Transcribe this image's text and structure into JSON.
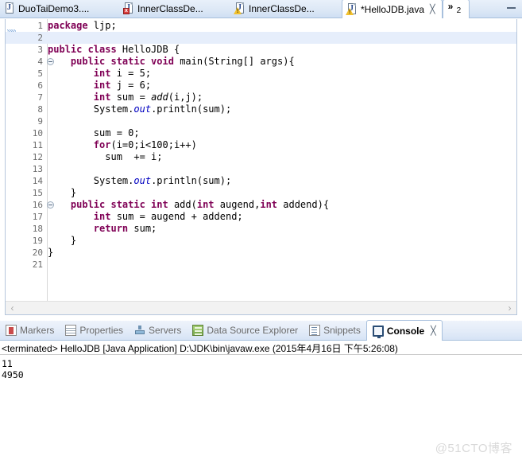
{
  "editor": {
    "tabs": [
      {
        "label": "DuoTaiDemo3....",
        "icon": "java-file-icon",
        "badge": "none",
        "active": false,
        "closable": false
      },
      {
        "label": "InnerClassDe...",
        "icon": "java-file-icon",
        "badge": "error",
        "badge_glyph": "x",
        "active": false,
        "closable": false
      },
      {
        "label": "InnerClassDe...",
        "icon": "java-file-icon",
        "badge": "warning",
        "badge_glyph": "!",
        "active": false,
        "closable": false
      },
      {
        "label": "*HelloJDB.java",
        "icon": "java-file-icon",
        "badge": "warning",
        "badge_glyph": "!",
        "active": true,
        "closable": true,
        "close_glyph": "╳"
      }
    ],
    "overflow": {
      "chevron": "»",
      "count": "2",
      "name": "more-tabs-chevron"
    },
    "minimize_button": "minimize-icon",
    "hscroll": {
      "left_arrow": "‹",
      "right_arrow": "›"
    },
    "current_line": 2,
    "code_lines": [
      {
        "n": "1",
        "fold": false,
        "tokens": [
          {
            "t": "package ",
            "c": "kw"
          },
          {
            "t": "ljp;",
            "c": "pl"
          }
        ]
      },
      {
        "n": "2",
        "fold": false,
        "tokens": [
          {
            "t": "",
            "c": "pl"
          }
        ]
      },
      {
        "n": "3",
        "fold": false,
        "tokens": [
          {
            "t": "public class ",
            "c": "kw"
          },
          {
            "t": "HelloJDB {",
            "c": "pl"
          }
        ]
      },
      {
        "n": "4",
        "fold": true,
        "tokens": [
          {
            "t": "    ",
            "c": "pl"
          },
          {
            "t": "public static void ",
            "c": "kw"
          },
          {
            "t": "main(",
            "c": "pl"
          },
          {
            "t": "String[] args){",
            "c": "pl"
          }
        ]
      },
      {
        "n": "5",
        "fold": false,
        "tokens": [
          {
            "t": "        ",
            "c": "pl"
          },
          {
            "t": "int ",
            "c": "kw"
          },
          {
            "t": "i = 5;",
            "c": "pl"
          }
        ]
      },
      {
        "n": "6",
        "fold": false,
        "tokens": [
          {
            "t": "        ",
            "c": "pl"
          },
          {
            "t": "int ",
            "c": "kw"
          },
          {
            "t": "j = 6;",
            "c": "pl"
          }
        ]
      },
      {
        "n": "7",
        "fold": false,
        "tokens": [
          {
            "t": "        ",
            "c": "pl"
          },
          {
            "t": "int ",
            "c": "kw"
          },
          {
            "t": "sum = ",
            "c": "pl"
          },
          {
            "t": "add",
            "c": "it"
          },
          {
            "t": "(i,j);",
            "c": "pl"
          }
        ]
      },
      {
        "n": "8",
        "fold": false,
        "tokens": [
          {
            "t": "        System.",
            "c": "pl"
          },
          {
            "t": "out",
            "c": "fld"
          },
          {
            "t": ".println(sum);",
            "c": "pl"
          }
        ]
      },
      {
        "n": "9",
        "fold": false,
        "tokens": [
          {
            "t": "",
            "c": "pl"
          }
        ]
      },
      {
        "n": "10",
        "fold": false,
        "tokens": [
          {
            "t": "        sum = 0;",
            "c": "pl"
          }
        ]
      },
      {
        "n": "11",
        "fold": false,
        "tokens": [
          {
            "t": "        ",
            "c": "pl"
          },
          {
            "t": "for",
            "c": "kw"
          },
          {
            "t": "(i=0;i<100;i++)",
            "c": "pl"
          }
        ]
      },
      {
        "n": "12",
        "fold": false,
        "tokens": [
          {
            "t": "          sum  += i;",
            "c": "pl"
          }
        ]
      },
      {
        "n": "13",
        "fold": false,
        "tokens": [
          {
            "t": "",
            "c": "pl"
          }
        ]
      },
      {
        "n": "14",
        "fold": false,
        "tokens": [
          {
            "t": "        System.",
            "c": "pl"
          },
          {
            "t": "out",
            "c": "fld"
          },
          {
            "t": ".println(sum);",
            "c": "pl"
          }
        ]
      },
      {
        "n": "15",
        "fold": false,
        "tokens": [
          {
            "t": "    }",
            "c": "pl"
          }
        ]
      },
      {
        "n": "16",
        "fold": true,
        "tokens": [
          {
            "t": "    ",
            "c": "pl"
          },
          {
            "t": "public static int ",
            "c": "kw"
          },
          {
            "t": "add(",
            "c": "pl"
          },
          {
            "t": "int ",
            "c": "kw"
          },
          {
            "t": "augend,",
            "c": "pl"
          },
          {
            "t": "int ",
            "c": "kw"
          },
          {
            "t": "addend){",
            "c": "pl"
          }
        ]
      },
      {
        "n": "17",
        "fold": false,
        "tokens": [
          {
            "t": "        ",
            "c": "pl"
          },
          {
            "t": "int ",
            "c": "kw"
          },
          {
            "t": "sum = augend + addend;",
            "c": "pl"
          }
        ]
      },
      {
        "n": "18",
        "fold": false,
        "tokens": [
          {
            "t": "        ",
            "c": "pl"
          },
          {
            "t": "return ",
            "c": "kw"
          },
          {
            "t": "sum;",
            "c": "pl"
          }
        ]
      },
      {
        "n": "19",
        "fold": false,
        "tokens": [
          {
            "t": "    }",
            "c": "pl"
          }
        ]
      },
      {
        "n": "20",
        "fold": false,
        "tokens": [
          {
            "t": "}",
            "c": "pl"
          }
        ]
      },
      {
        "n": "21",
        "fold": false,
        "tokens": [
          {
            "t": "",
            "c": "pl"
          }
        ]
      }
    ]
  },
  "bottom": {
    "tabs": [
      {
        "label": "Markers",
        "icon": "markers-icon",
        "active": false
      },
      {
        "label": "Properties",
        "icon": "properties-icon",
        "active": false
      },
      {
        "label": "Servers",
        "icon": "servers-icon",
        "active": false
      },
      {
        "label": "Data Source Explorer",
        "icon": "data-source-explorer-icon",
        "active": false
      },
      {
        "label": "Snippets",
        "icon": "snippets-icon",
        "active": false
      },
      {
        "label": "Console",
        "icon": "console-icon",
        "active": true,
        "close_glyph": "╳"
      }
    ],
    "console": {
      "status_line": "<terminated> HelloJDB [Java Application] D:\\JDK\\bin\\javaw.exe (2015年4月16日 下午5:26:08)",
      "output": "11\n4950"
    }
  },
  "watermark": "@51CTO博客",
  "colors": {
    "keyword": "#7f0055",
    "field": "#0000c0",
    "tab_active_bg": "#ffffff",
    "tabbar_bg": "#dde8f6",
    "current_line_bg": "#e6eefb"
  }
}
